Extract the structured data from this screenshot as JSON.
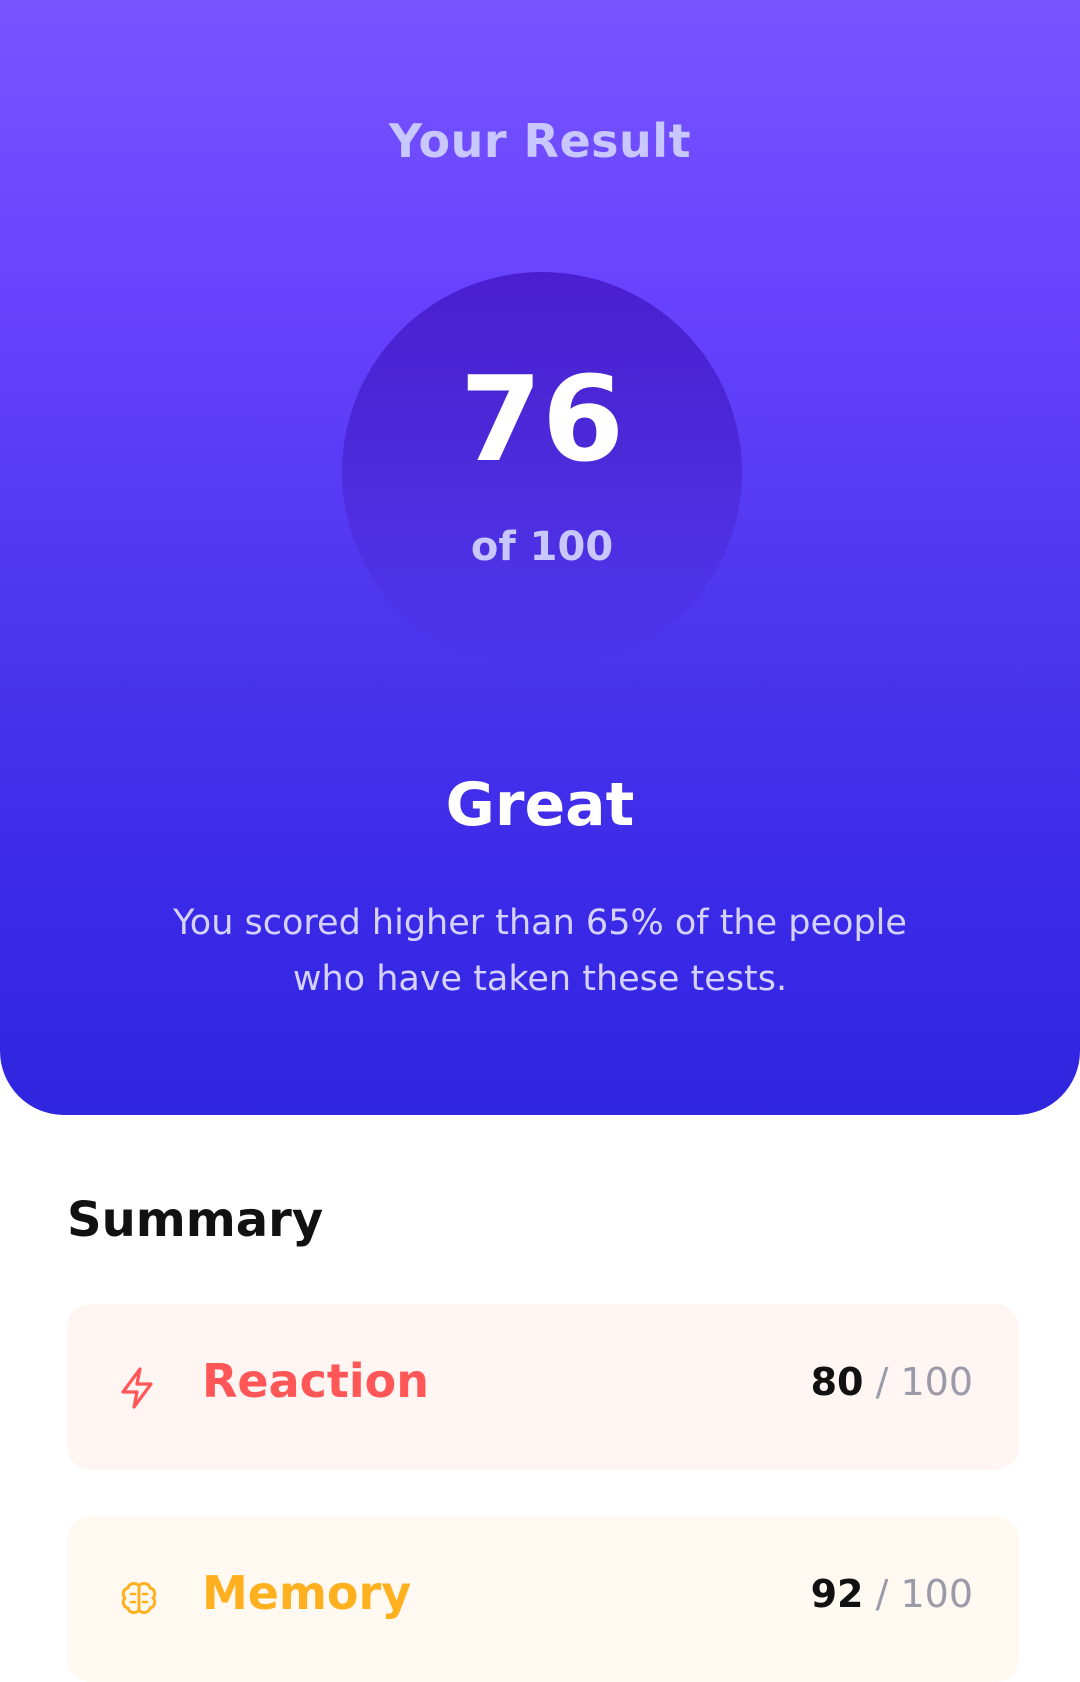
{
  "result": {
    "title": "Your Result",
    "score": "76",
    "max_label": "of 100",
    "verdict": "Great",
    "description": "You scored higher than 65% of the people who have taken these tests."
  },
  "summary": {
    "title": "Summary",
    "items": [
      {
        "label": "Reaction",
        "score": "80",
        "separator": "/",
        "max": "100",
        "icon": "lightning-icon",
        "color": "#ff5757"
      },
      {
        "label": "Memory",
        "score": "92",
        "separator": "/",
        "max": "100",
        "icon": "brain-icon",
        "color": "#ffb01f"
      }
    ]
  },
  "colors": {
    "gradient_top": "#7755ff",
    "gradient_bottom": "#2f26df"
  }
}
